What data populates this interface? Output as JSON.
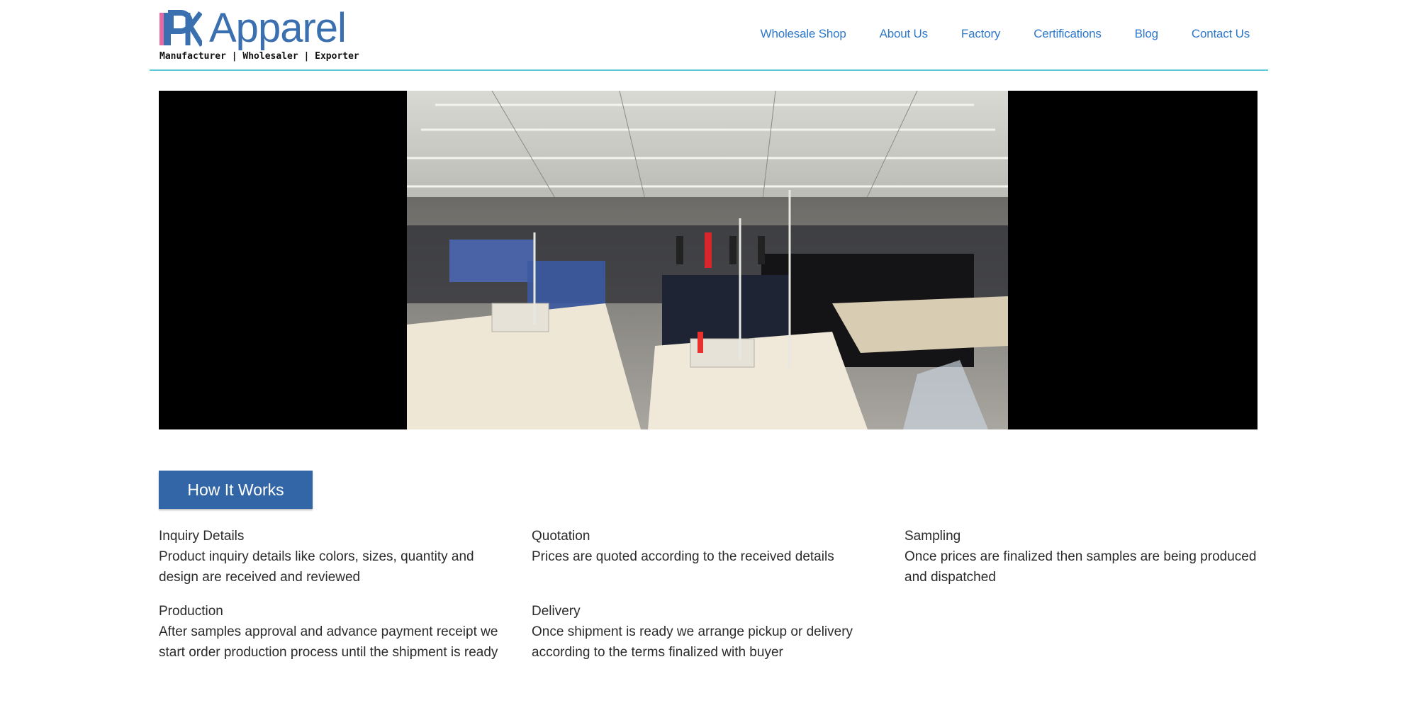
{
  "brand": {
    "name": "Apparel",
    "tagline": "Manufacturer | Wholesaler | Exporter"
  },
  "nav": {
    "items": [
      {
        "label": "Wholesale Shop"
      },
      {
        "label": "About Us"
      },
      {
        "label": "Factory"
      },
      {
        "label": "Certifications"
      },
      {
        "label": "Blog"
      },
      {
        "label": "Contact Us"
      }
    ]
  },
  "hero": {
    "icon": "factory-sewing-floor-photo"
  },
  "how": {
    "button_label": "How It Works",
    "steps": [
      {
        "title": "Inquiry Details",
        "desc": "Product inquiry details like colors, sizes, quantity and design are received and reviewed"
      },
      {
        "title": "Quotation",
        "desc": "Prices are quoted according to the received details"
      },
      {
        "title": "Sampling",
        "desc": "Once prices are finalized then samples are being produced and dispatched"
      },
      {
        "title": "Production",
        "desc": "After samples approval and advance payment receipt we start order production process until the shipment is ready"
      },
      {
        "title": "Delivery",
        "desc": "Once shipment is ready we arrange pickup or delivery according to the terms finalized with buyer"
      }
    ]
  },
  "colors": {
    "accent": "#3366a6",
    "nav_link": "#2f78c8",
    "header_rule": "#5cc8d8"
  }
}
